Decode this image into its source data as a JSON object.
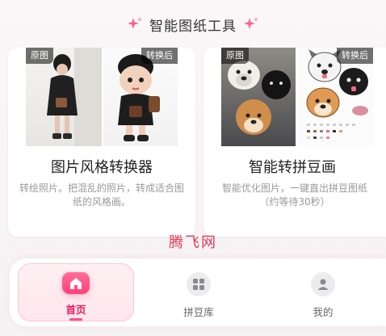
{
  "header": {
    "title": "智能图纸工具",
    "accent_color": "#ff5c92"
  },
  "cards": [
    {
      "title": "图片风格转换器",
      "description": "转绘照片。把混乱的照片，转成适合图纸的风格画。",
      "original_tag": "原图",
      "converted_tag": "转换后"
    },
    {
      "title": "智能转拼豆画",
      "description": "智能优化图片，一键直出拼豆图纸（约等待30秒）",
      "original_tag": "原图",
      "converted_tag": "转换后"
    }
  ],
  "watermark": "腾飞网",
  "tabbar": {
    "items": [
      {
        "label": "首页",
        "icon": "home-icon",
        "active": true
      },
      {
        "label": "拼豆库",
        "icon": "grid-icon",
        "active": false
      },
      {
        "label": "我的",
        "icon": "user-icon",
        "active": false
      }
    ]
  }
}
